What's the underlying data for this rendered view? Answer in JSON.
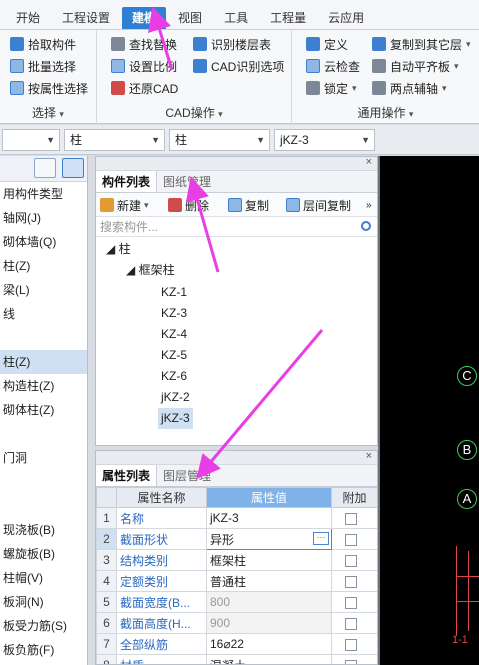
{
  "ribbon": {
    "tabs": [
      "开始",
      "工程设置",
      "建模",
      "视图",
      "工具",
      "工程量",
      "云应用"
    ],
    "active_tab": "建模",
    "groups": {
      "select": {
        "title": "选择",
        "buttons": [
          "拾取构件",
          "批量选择",
          "按属性选择"
        ]
      },
      "cad": {
        "title": "CAD操作",
        "buttons": [
          "查找替换",
          "识别楼层表",
          "设置比例",
          "CAD识别选项",
          "还原CAD"
        ]
      },
      "common": {
        "title": "通用操作",
        "buttons": [
          "定义",
          "复制到其它层",
          "云检查",
          "自动平齐板",
          "锁定",
          "两点辅轴"
        ]
      }
    }
  },
  "combos": [
    "",
    "柱",
    "柱",
    "jKZ-3"
  ],
  "left_panel": {
    "items": [
      "用构件类型",
      "轴网(J)",
      "砌体墙(Q)",
      "柱(Z)",
      "梁(L)",
      "线",
      "",
      "柱(Z)",
      "构造柱(Z)",
      "砌体柱(Z)",
      "",
      "门洞",
      "",
      "",
      "现浇板(B)",
      "螺旋板(B)",
      "柱帽(V)",
      "板洞(N)",
      "板受力筋(S)",
      "板负筋(F)"
    ]
  },
  "component_panel": {
    "tabs": [
      "构件列表",
      "图纸管理"
    ],
    "toolbar": [
      "新建",
      "删除",
      "复制",
      "层间复制"
    ],
    "search_placeholder": "搜索构件...",
    "tree": {
      "root": "柱",
      "group": "框架柱",
      "items": [
        "KZ-1",
        "KZ-3",
        "KZ-4",
        "KZ-5",
        "KZ-6",
        "jKZ-2",
        "jKZ-3"
      ],
      "selected": "jKZ-3"
    }
  },
  "property_panel": {
    "tabs": [
      "属性列表",
      "图层管理"
    ],
    "headers": [
      "",
      "属性名称",
      "属性值",
      "附加"
    ],
    "rows": [
      {
        "num": "1",
        "name": "名称",
        "value": "jKZ-3"
      },
      {
        "num": "2",
        "name": "截面形状",
        "value": "异形"
      },
      {
        "num": "3",
        "name": "结构类别",
        "value": "框架柱"
      },
      {
        "num": "4",
        "name": "定额类别",
        "value": "普通柱"
      },
      {
        "num": "5",
        "name": "截面宽度(B...",
        "value": "800"
      },
      {
        "num": "6",
        "name": "截面高度(H...",
        "value": "900"
      },
      {
        "num": "7",
        "name": "全部纵筋",
        "value": "16⌀22"
      },
      {
        "num": "8",
        "name": "材质",
        "value": "混凝土"
      }
    ]
  },
  "canvas": {
    "axis_labels": [
      "C",
      "B",
      "A"
    ],
    "section_label": "1-1"
  }
}
